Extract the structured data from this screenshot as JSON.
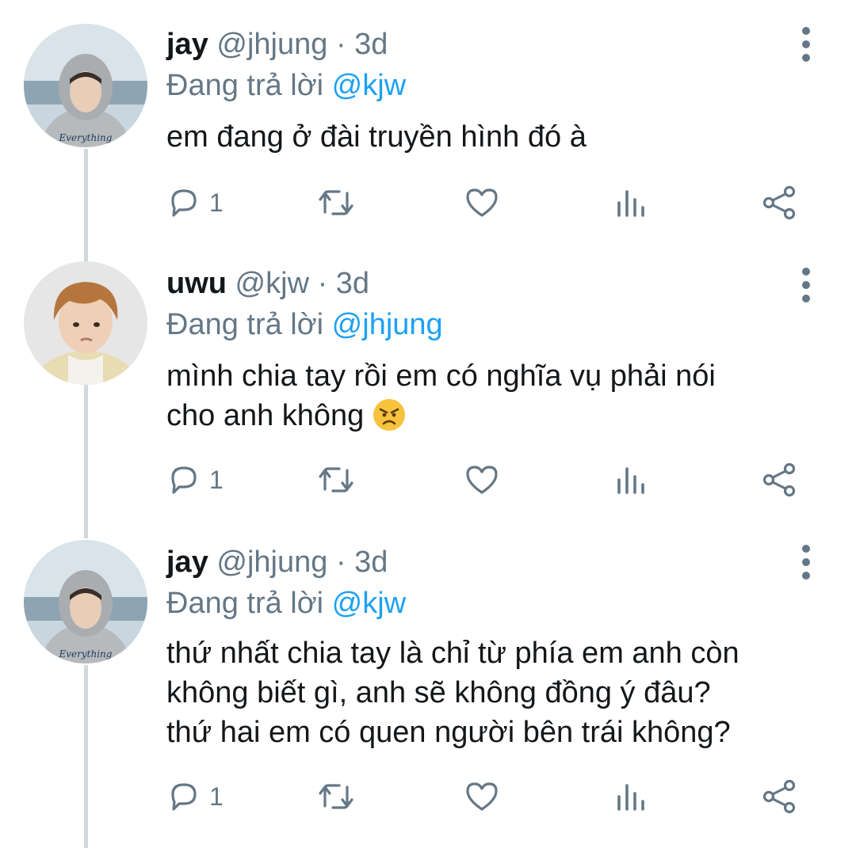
{
  "colors": {
    "text": "#14171a",
    "muted": "#657786",
    "link": "#1da1f2",
    "thread_line": "#cfd9de"
  },
  "tweets": [
    {
      "name": "jay",
      "handle": "@jhjung",
      "dot": "·",
      "time": "3d",
      "replying_prefix": "Đang trả lời ",
      "replying_to": "@kjw",
      "text": "em đang ở đài truyền hình đó à",
      "reply_count": "1",
      "avatar_icon": "avatar-hoodie-photo",
      "avatar_text": "Everything"
    },
    {
      "name": "uwu",
      "handle": "@kjw",
      "dot": "·",
      "time": "3d",
      "replying_prefix": "Đang trả lời ",
      "replying_to": "@jhjung",
      "text_line1": "mình chia tay rồi em có nghĩa vụ phải nói",
      "text_line2": "cho anh không",
      "emoji_icon": "angry-face-emoji",
      "reply_count": "1",
      "avatar_icon": "avatar-portrait-photo"
    },
    {
      "name": "jay",
      "handle": "@jhjung",
      "dot": "·",
      "time": "3d",
      "replying_prefix": "Đang trả lời ",
      "replying_to": "@kjw",
      "text_line1": "thứ nhất chia tay là chỉ từ phía em anh còn",
      "text_line2": "không biết gì, anh sẽ không đồng ý đâu?",
      "text_line3": "thứ hai em có quen người bên trái không?",
      "reply_count": "1",
      "avatar_icon": "avatar-hoodie-photo",
      "avatar_text": "Everything"
    }
  ]
}
